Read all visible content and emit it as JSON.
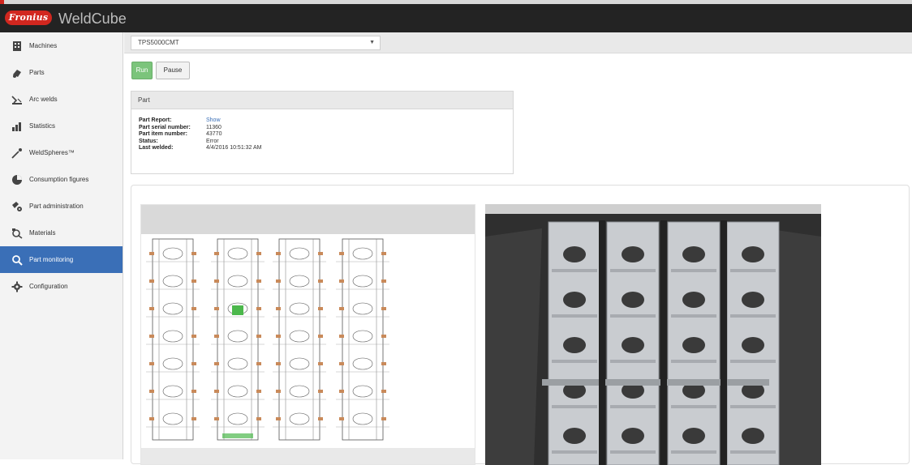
{
  "app": {
    "brand": "Fronius",
    "title": "WeldCube"
  },
  "sidebar": {
    "items": [
      {
        "label": "Machines",
        "icon": "building-icon"
      },
      {
        "label": "Parts",
        "icon": "parts-icon"
      },
      {
        "label": "Arc welds",
        "icon": "arc-weld-icon"
      },
      {
        "label": "Statistics",
        "icon": "statistics-icon"
      },
      {
        "label": "WeldSpheres™",
        "icon": "weld-sphere-icon"
      },
      {
        "label": "Consumption figures",
        "icon": "pie-icon"
      },
      {
        "label": "Part administration",
        "icon": "part-admin-icon"
      },
      {
        "label": "Materials",
        "icon": "materials-icon"
      },
      {
        "label": "Part monitoring",
        "icon": "search-icon"
      },
      {
        "label": "Configuration",
        "icon": "gear-icon"
      }
    ],
    "active_index": 8
  },
  "machine": {
    "selected": "TPS5000CMT"
  },
  "controls": {
    "run_label": "Run",
    "pause_label": "Pause"
  },
  "part": {
    "heading": "Part",
    "fields": [
      {
        "key": "Part Report:",
        "value": "Show"
      },
      {
        "key": "Part serial number:",
        "value": "11360"
      },
      {
        "key": "Part item number:",
        "value": "43770"
      },
      {
        "key": "Status:",
        "value": "Error"
      },
      {
        "key": "Last welded:",
        "value": "4/4/2016 10:51:32 AM"
      }
    ]
  },
  "colors": {
    "accent": "#3a6fb7",
    "brand": "#d2271f",
    "run": "#7bc47b",
    "highlight": "#4cb84c"
  }
}
